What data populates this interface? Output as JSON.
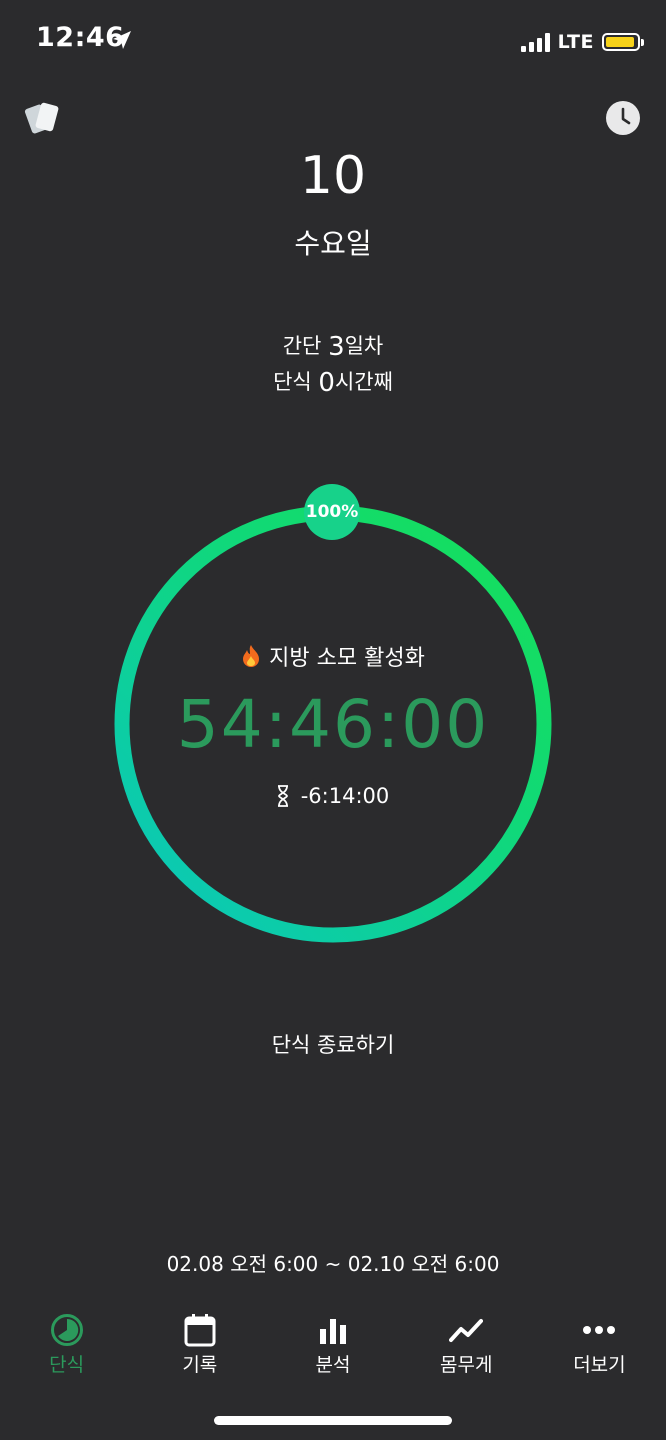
{
  "status_bar": {
    "time": "12:46",
    "network": "LTE"
  },
  "header": {
    "date_number": "10",
    "weekday": "수요일"
  },
  "summary": {
    "intermittent_prefix": "간단 ",
    "intermittent_days": "3",
    "intermittent_suffix": "일차",
    "fasting_prefix": "단식 ",
    "fasting_hours": "0",
    "fasting_suffix": "시간째"
  },
  "progress": {
    "percent_label": "100%",
    "percent_value": 100,
    "phase": "지방 소모 활성화",
    "elapsed": "54:46:00",
    "remaining": "-6:14:00"
  },
  "actions": {
    "end_fast": "단식 종료하기"
  },
  "schedule": {
    "range": "02.08 오전 6:00 ~ 02.10 오전 6:00"
  },
  "tabs": [
    {
      "label": "단식",
      "icon": "fasting-timer-icon",
      "active": true
    },
    {
      "label": "기록",
      "icon": "calendar-icon",
      "active": false
    },
    {
      "label": "분석",
      "icon": "bar-chart-icon",
      "active": false
    },
    {
      "label": "몸무게",
      "icon": "trend-line-icon",
      "active": false
    },
    {
      "label": "더보기",
      "icon": "more-dots-icon",
      "active": false
    }
  ],
  "colors": {
    "background": "#2b2b2d",
    "accent_green": "#2b9a5c",
    "ring_start": "#0ac6c0",
    "ring_end": "#17e055",
    "battery": "#f7d21a"
  }
}
